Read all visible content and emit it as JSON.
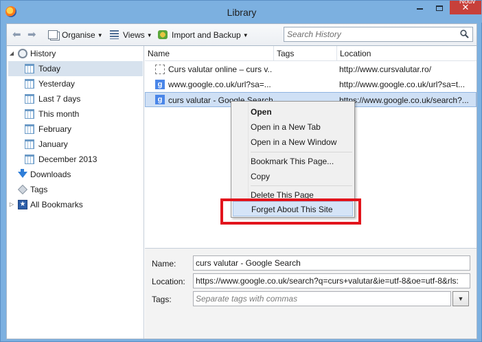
{
  "window": {
    "title": "Library",
    "edge_text": "Nouv"
  },
  "toolbar": {
    "organise_label": "Organise",
    "views_label": "Views",
    "import_label": "Import and Backup",
    "search_placeholder": "Search History"
  },
  "sidebar": {
    "items": [
      {
        "label": "History"
      },
      {
        "label": "Today"
      },
      {
        "label": "Yesterday"
      },
      {
        "label": "Last 7 days"
      },
      {
        "label": "This month"
      },
      {
        "label": "February"
      },
      {
        "label": "January"
      },
      {
        "label": "December 2013"
      },
      {
        "label": "Downloads"
      },
      {
        "label": "Tags"
      },
      {
        "label": "All Bookmarks"
      }
    ]
  },
  "columns": {
    "name": "Name",
    "tags": "Tags",
    "location": "Location"
  },
  "rows": [
    {
      "name": "Curs valutar online – curs v...",
      "tags": "",
      "location": "http://www.cursvalutar.ro/",
      "icon": "blank-page-icon"
    },
    {
      "name": "www.google.co.uk/url?sa=...",
      "tags": "",
      "location": "http://www.google.co.uk/url?sa=t...",
      "icon": "google-favicon"
    },
    {
      "name": "curs valutar - Google Search",
      "tags": "",
      "location": "https://www.google.co.uk/search?...",
      "icon": "google-favicon"
    }
  ],
  "context_menu": {
    "open": "Open",
    "open_tab": "Open in a New Tab",
    "open_window": "Open in a New Window",
    "bookmark": "Bookmark This Page...",
    "copy": "Copy",
    "delete": "Delete This Page",
    "forget": "Forget About This Site"
  },
  "details": {
    "name_label": "Name:",
    "name_value": "curs valutar - Google Search",
    "location_label": "Location:",
    "location_value": "https://www.google.co.uk/search?q=curs+valutar&ie=utf-8&oe=utf-8&rls:",
    "tags_label": "Tags:",
    "tags_placeholder": "Separate tags with commas"
  },
  "colors": {
    "frame": "#7cb0e0",
    "close_button": "#c7403a",
    "selection": "#cfe0f5",
    "highlight_box": "#e2141c"
  }
}
